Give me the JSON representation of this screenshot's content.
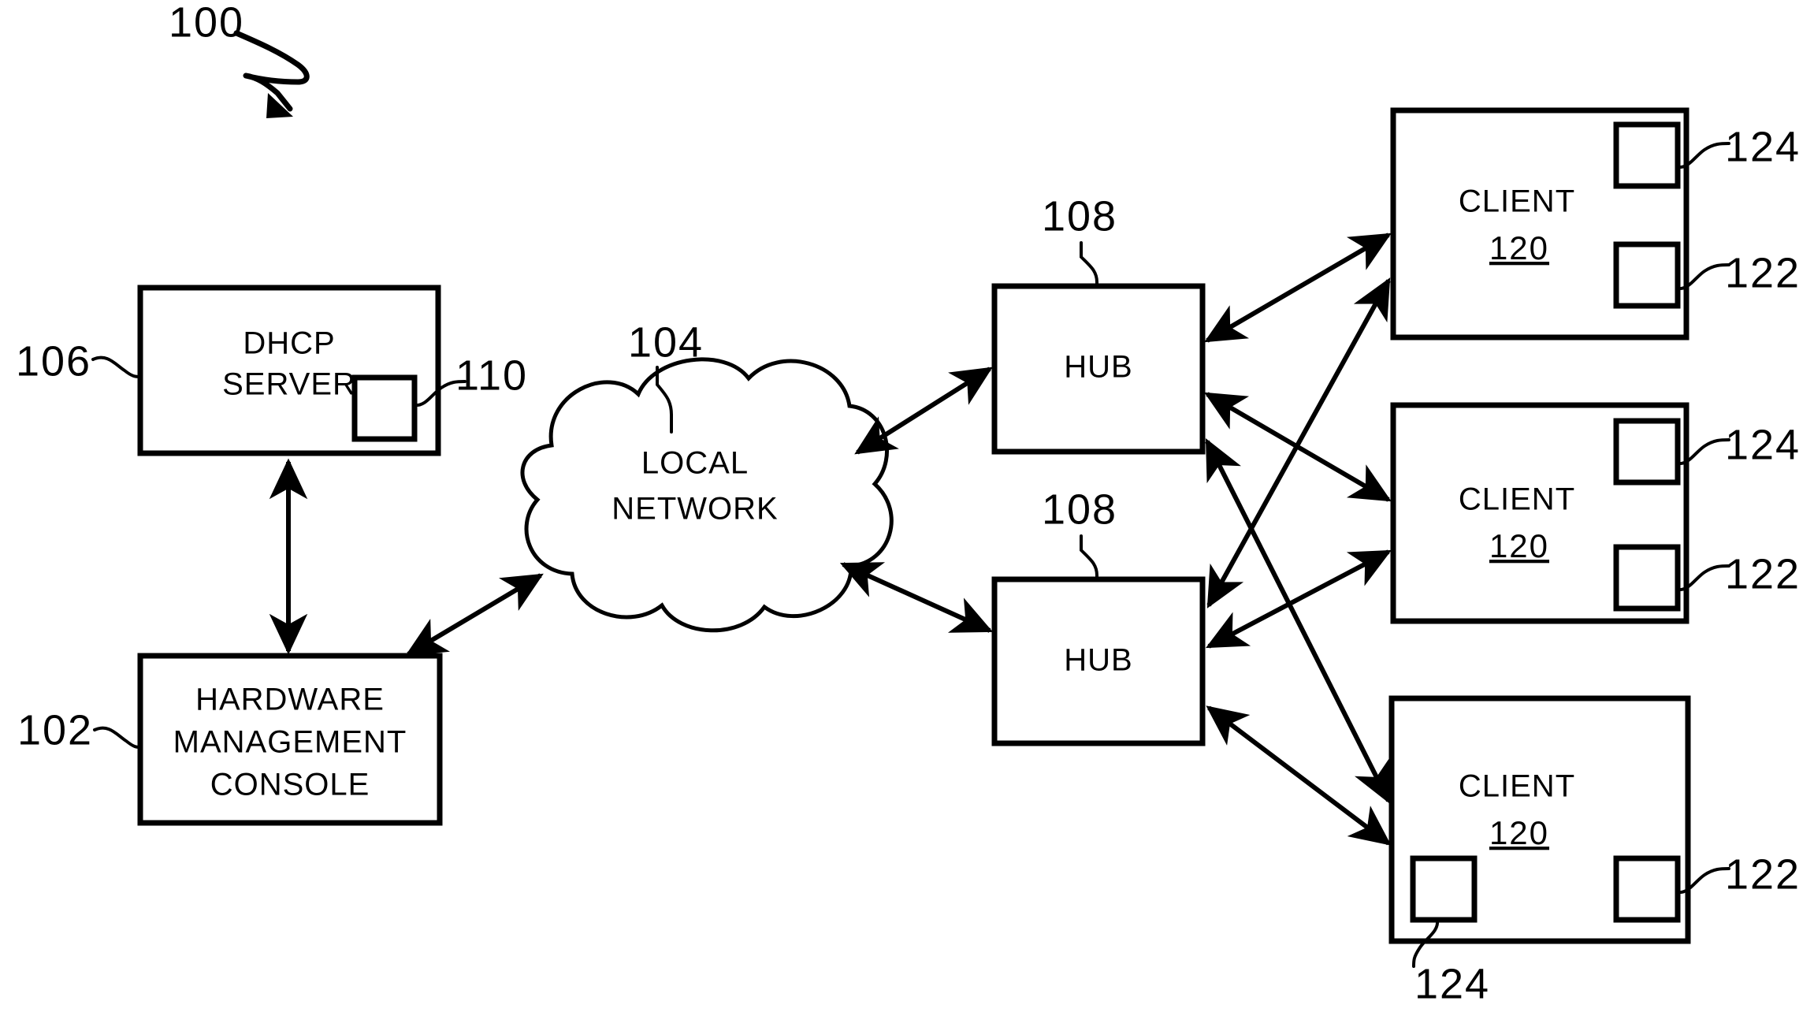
{
  "figure": {
    "number": "100",
    "type": "patent-network-diagram"
  },
  "nodes": {
    "dhcp_server": {
      "label_line1": "DHCP",
      "label_line2": "SERVER",
      "ref": "106",
      "component_ref": "110"
    },
    "hardware_management_console": {
      "label_line1": "HARDWARE",
      "label_line2": "MANAGEMENT",
      "label_line3": "CONSOLE",
      "ref": "102"
    },
    "local_network": {
      "label_line1": "LOCAL",
      "label_line2": "NETWORK",
      "ref": "104"
    },
    "hub_top": {
      "label": "HUB",
      "ref": "108"
    },
    "hub_bottom": {
      "label": "HUB",
      "ref": "108"
    },
    "client_1": {
      "label": "CLIENT",
      "number": "120",
      "port_upper_ref": "124",
      "port_lower_ref": "122"
    },
    "client_2": {
      "label": "CLIENT",
      "number": "120",
      "port_upper_ref": "124",
      "port_lower_ref": "122"
    },
    "client_3": {
      "label": "CLIENT",
      "number": "120",
      "port_left_ref": "124",
      "port_right_ref": "122"
    }
  },
  "colors": {
    "stroke": "#000000",
    "background": "#ffffff"
  }
}
